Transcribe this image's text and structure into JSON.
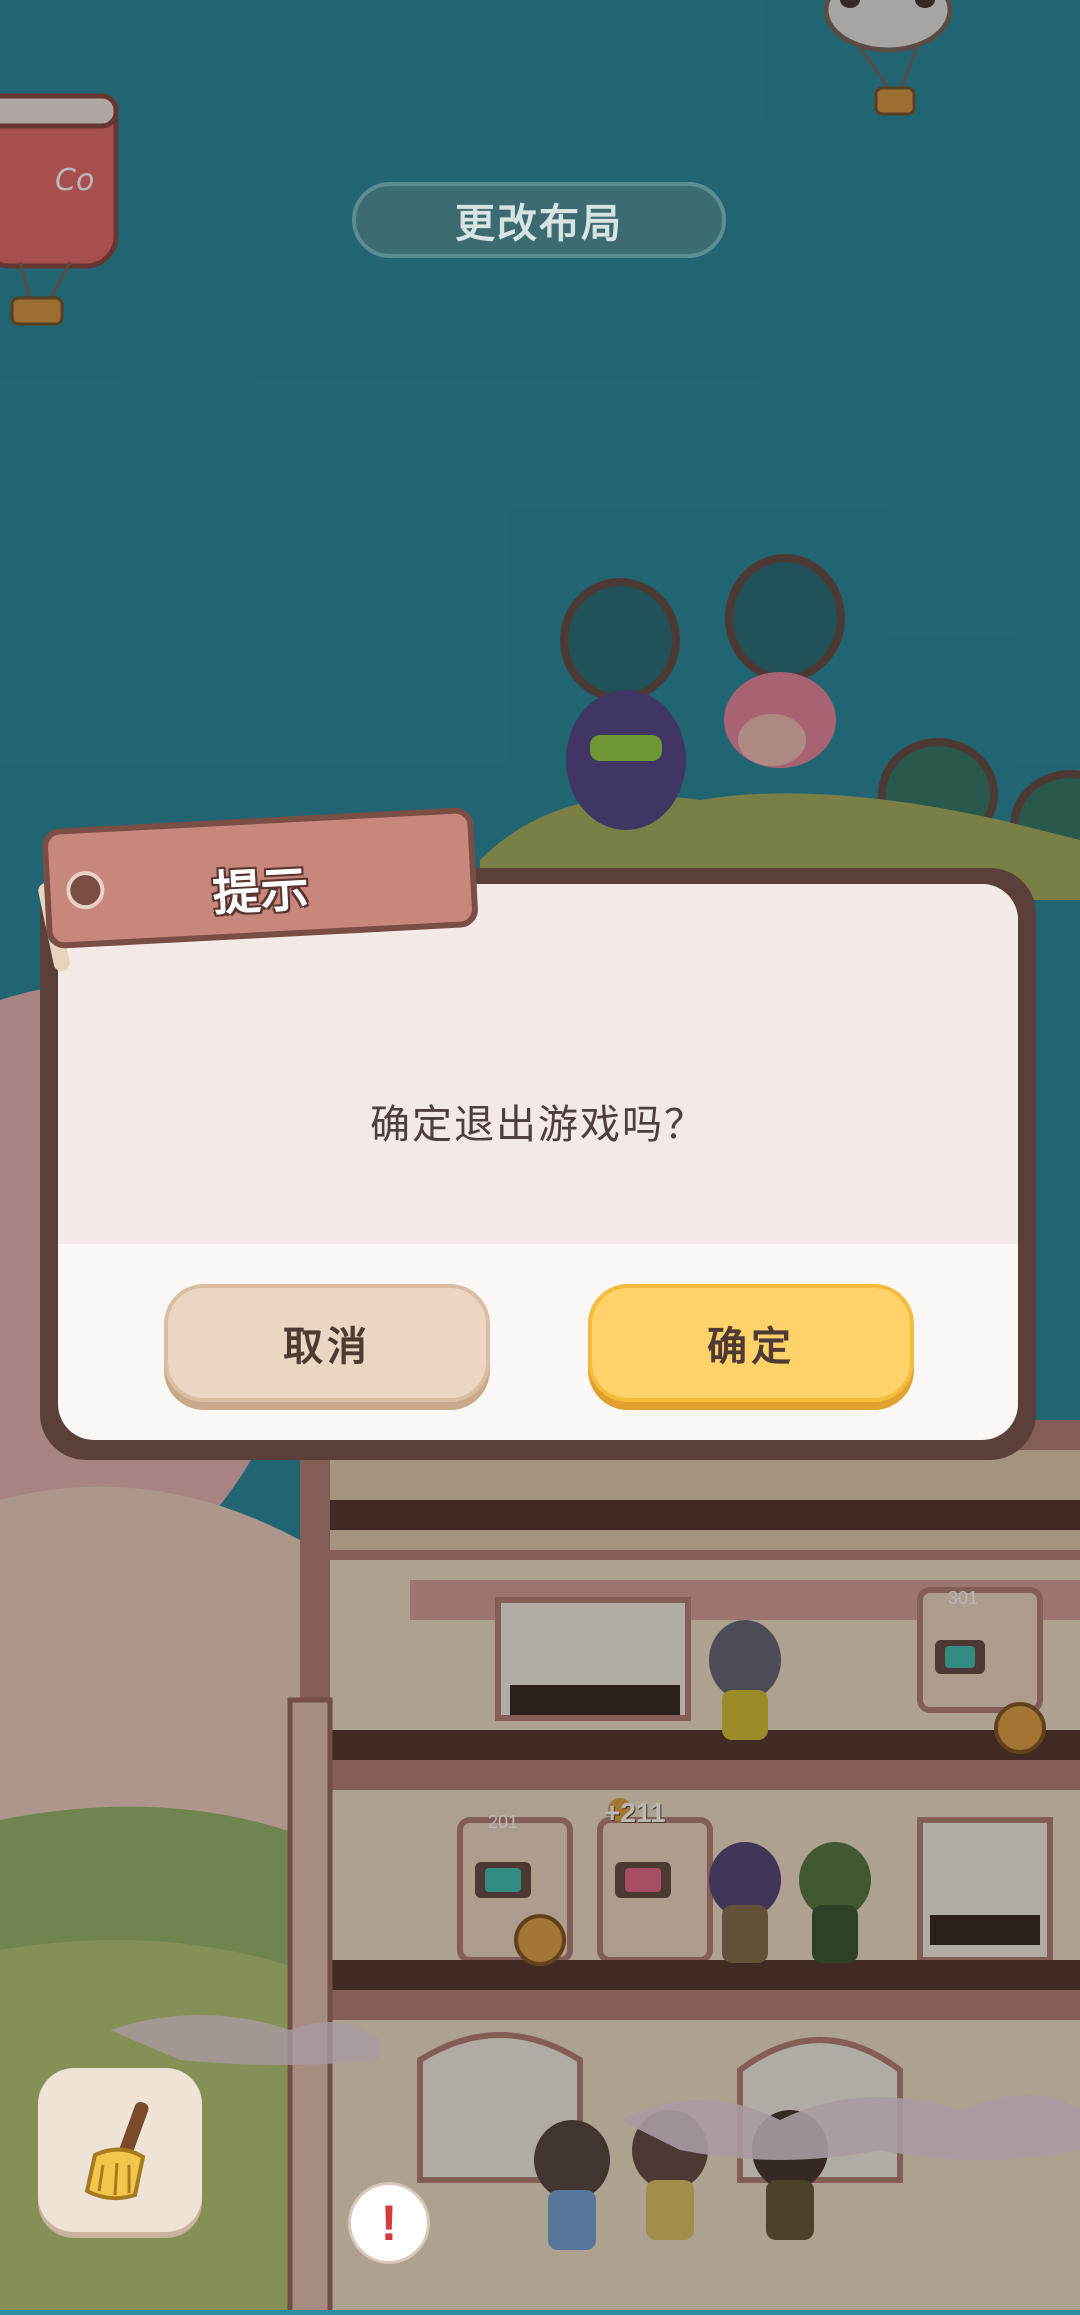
{
  "top_button": {
    "label": "更改布局"
  },
  "dialog": {
    "title": "提示",
    "message": "确定退出游戏吗？",
    "cancel_label": "取消",
    "confirm_label": "确定"
  },
  "scene": {
    "coin_bonus": "+211",
    "room_numbers": [
      "301",
      "201"
    ],
    "can_label": "Co"
  },
  "icons": [
    "broom-icon",
    "alert-icon",
    "hot-air-balloon-icon"
  ],
  "colors": {
    "sky": "#2f8da0",
    "dialog_border": "#5a3f3a",
    "confirm": "#ffd36a",
    "cancel": "#ead6c2",
    "tag": "#c8877d"
  }
}
